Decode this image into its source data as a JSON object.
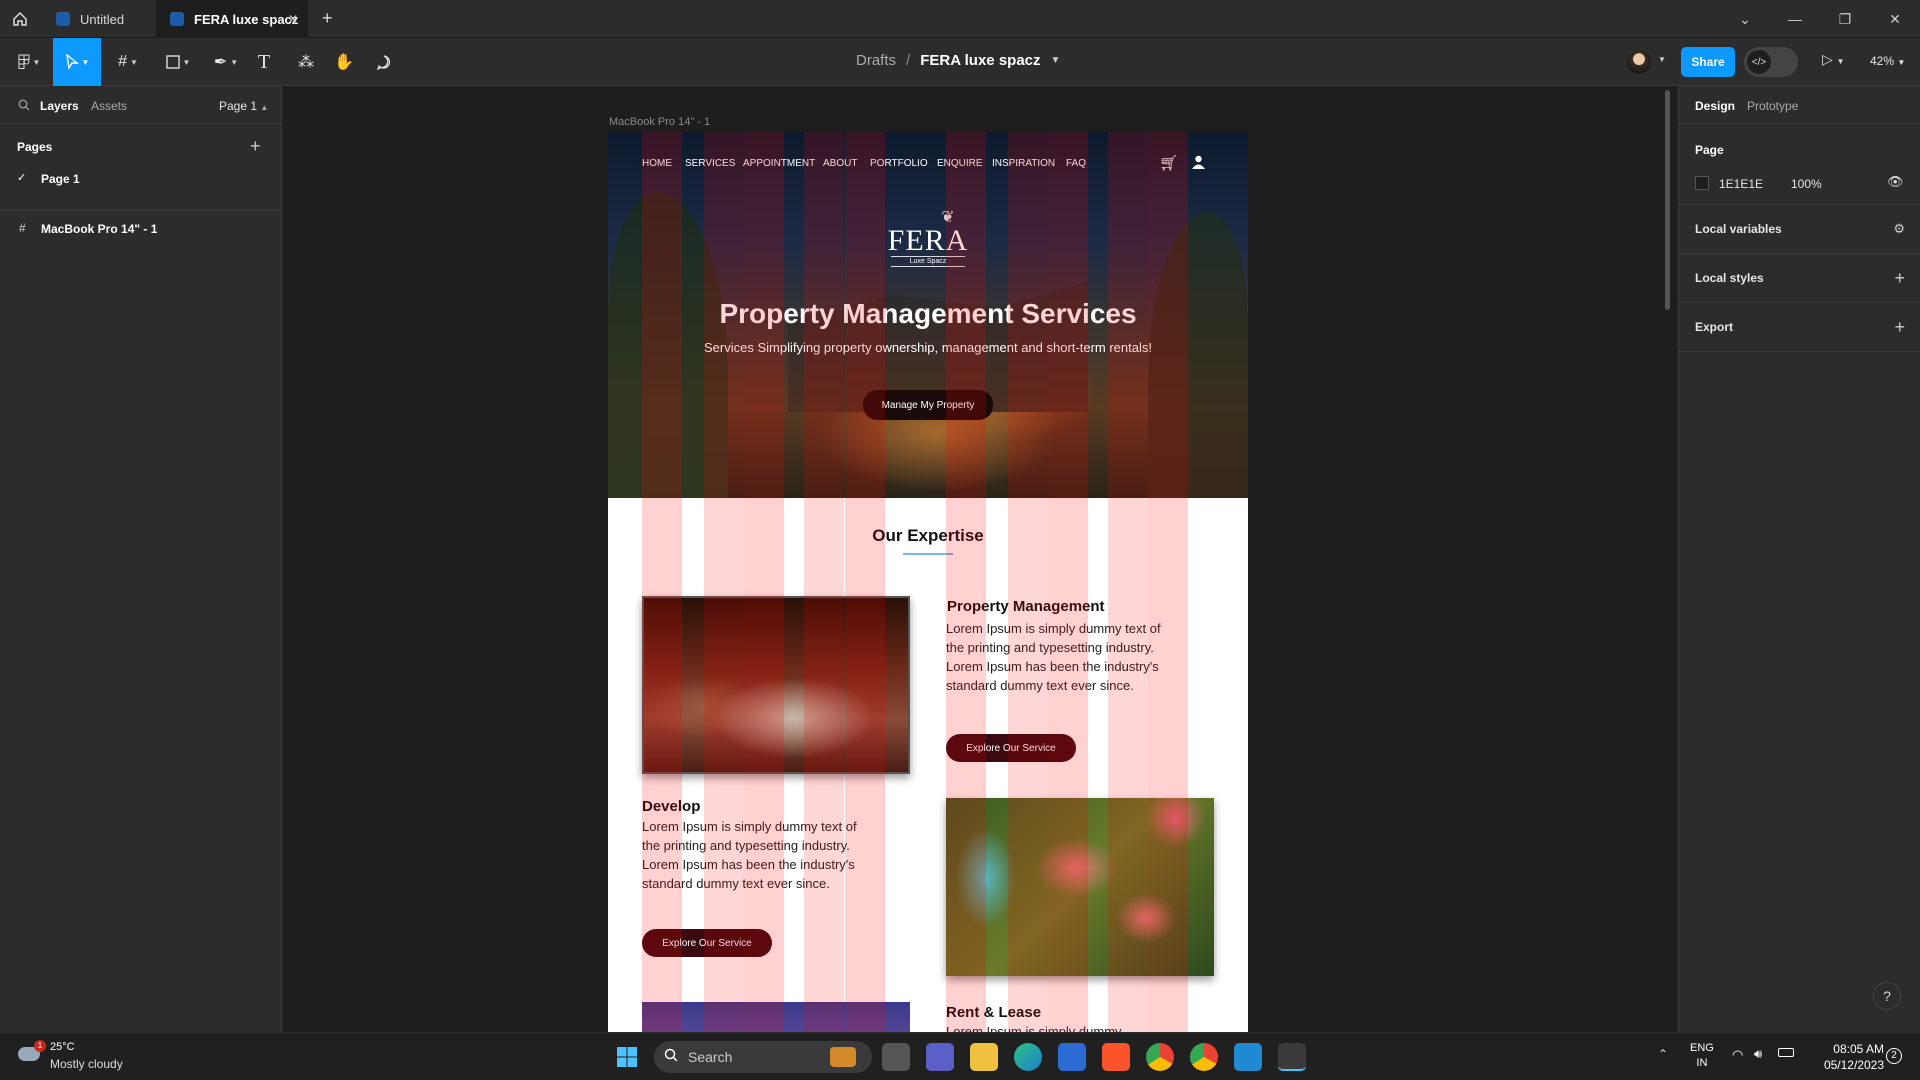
{
  "titlebar": {
    "tabs": [
      {
        "label": "Untitled"
      },
      {
        "label": "FERA luxe spacz"
      }
    ],
    "new_tab": "+",
    "close": "✕"
  },
  "toolbar": {
    "breadcrumb_root": "Drafts",
    "separator": "/",
    "file_name": "FERA luxe spacz",
    "share_label": "Share",
    "zoom": "42%"
  },
  "left": {
    "tabs": {
      "layers": "Layers",
      "assets": "Assets"
    },
    "page_selector": "Page 1",
    "pages_heading": "Pages",
    "pages": [
      {
        "label": "Page 1"
      }
    ],
    "layers": [
      {
        "label": "MacBook Pro 14\" - 1"
      }
    ]
  },
  "right": {
    "tabs": {
      "design": "Design",
      "prototype": "Prototype"
    },
    "page_heading": "Page",
    "page_color": "1E1E1E",
    "page_opacity": "100%",
    "sections": {
      "local_variables": "Local variables",
      "local_styles": "Local styles",
      "export": "Export"
    }
  },
  "canvas": {
    "frame_label": "MacBook Pro 14\" - 1",
    "site": {
      "nav": [
        "HOME",
        "SERVICES",
        "APPOINTMENT",
        "ABOUT",
        "PORTFOLIO",
        "ENQUIRE",
        "INSPIRATION",
        "FAQ"
      ],
      "logo_text": "FERA",
      "logo_sub": "Luxe Spacz",
      "hero_title": "Property Management Services",
      "hero_subtitle": "Services Simplifying property ownership, management and short-term rentals!",
      "hero_button": "Manage My Property",
      "expertise_heading": "Our Expertise",
      "services": [
        {
          "title": "Property Management",
          "text": "Lorem Ipsum is simply dummy text of the printing and typesetting industry. Lorem Ipsum has been the industry's standard dummy text ever since.",
          "button": "Explore Our Service"
        },
        {
          "title": "Develop",
          "text": "Lorem Ipsum is simply dummy text of the printing and typesetting industry. Lorem Ipsum has been the industry's standard dummy text ever since.",
          "button": "Explore Our Service"
        },
        {
          "title": "Rent & Lease",
          "text": "Lorem Ipsum is simply dummy"
        }
      ]
    }
  },
  "help": "?",
  "taskbar": {
    "weather_temp": "25°C",
    "weather_desc": "Mostly cloudy",
    "weather_badge": "1",
    "search_label": "Search",
    "lang": "ENG",
    "region": "IN",
    "time": "08:05 AM",
    "date": "05/12/2023",
    "notif_count": "2"
  },
  "colors": {
    "accent": "#0d99ff",
    "canvas": "#1E1E1E",
    "panel": "#2c2c2c",
    "site_button": "#3a0a10",
    "layout_grid": "#ff0000"
  }
}
